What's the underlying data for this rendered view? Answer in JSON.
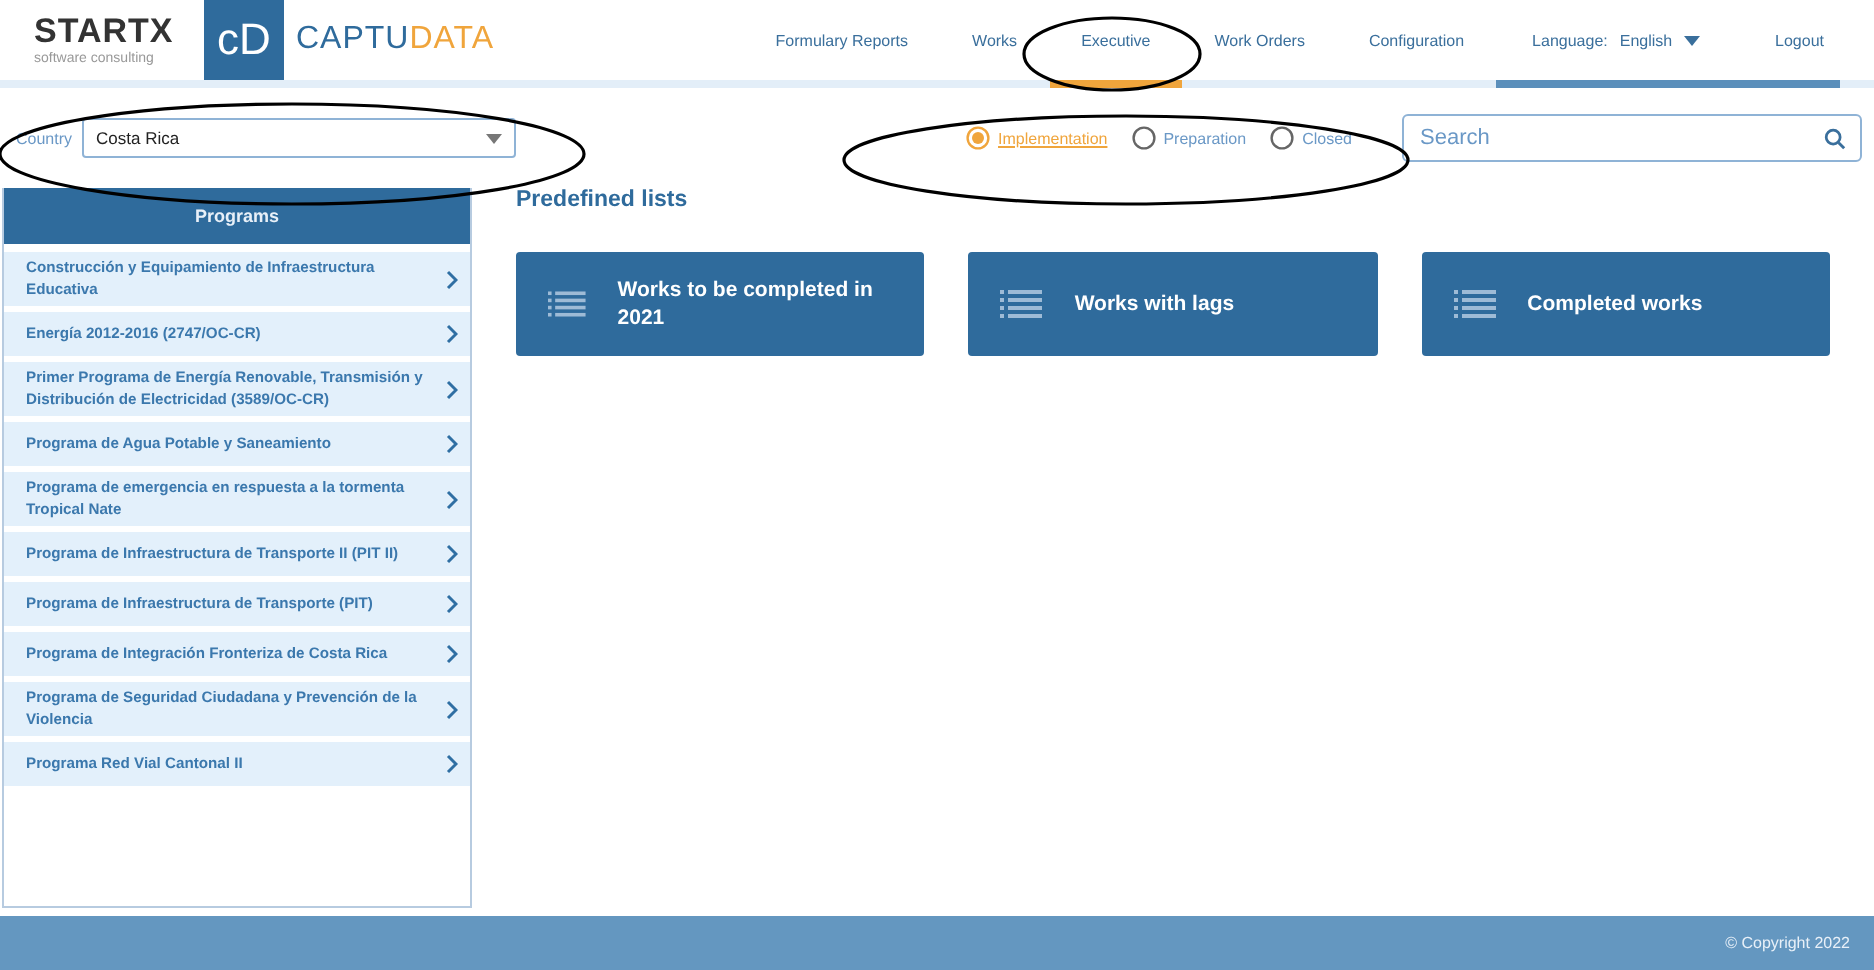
{
  "logo": {
    "brand": "STARTX",
    "tagline": "software consulting",
    "app_mark": "cD",
    "app_name_first": "CAPTU",
    "app_name_second": "DATA"
  },
  "nav": [
    {
      "label": "Formulary Reports",
      "selected": false
    },
    {
      "label": "Works",
      "selected": false
    },
    {
      "label": "Executive",
      "selected": true
    },
    {
      "label": "Work Orders",
      "selected": false
    },
    {
      "label": "Configuration",
      "selected": false
    }
  ],
  "language": {
    "label": "Language:",
    "value": "English"
  },
  "logout": "Logout",
  "country": {
    "label": "Country",
    "value": "Costa Rica"
  },
  "status_filter": [
    {
      "label": "Implementation",
      "selected": true
    },
    {
      "label": "Preparation",
      "selected": false
    },
    {
      "label": "Closed",
      "selected": false
    }
  ],
  "search": {
    "placeholder": "Search"
  },
  "sidebar": {
    "title": "Programs",
    "items": [
      "Construcción y Equipamiento de Infraestructura Educativa",
      "Energía 2012-2016 (2747/OC-CR)",
      "Primer Programa de Energía Renovable, Transmisión y Distribución de Electricidad (3589/OC-CR)",
      "Programa de Agua Potable y Saneamiento",
      "Programa de emergencia en respuesta a la tormenta Tropical Nate",
      "Programa de Infraestructura de Transporte II (PIT II)",
      "Programa de Infraestructura de Transporte (PIT)",
      "Programa de Integración Fronteriza de Costa Rica",
      "Programa de Seguridad Ciudadana y Prevención de la Violencia",
      "Programa Red Vial Cantonal II"
    ]
  },
  "predefined": {
    "title": "Predefined lists",
    "cards": [
      "Works to be completed in 2021",
      "Works with lags",
      "Completed works"
    ]
  },
  "footer": "© Copyright 2022"
}
